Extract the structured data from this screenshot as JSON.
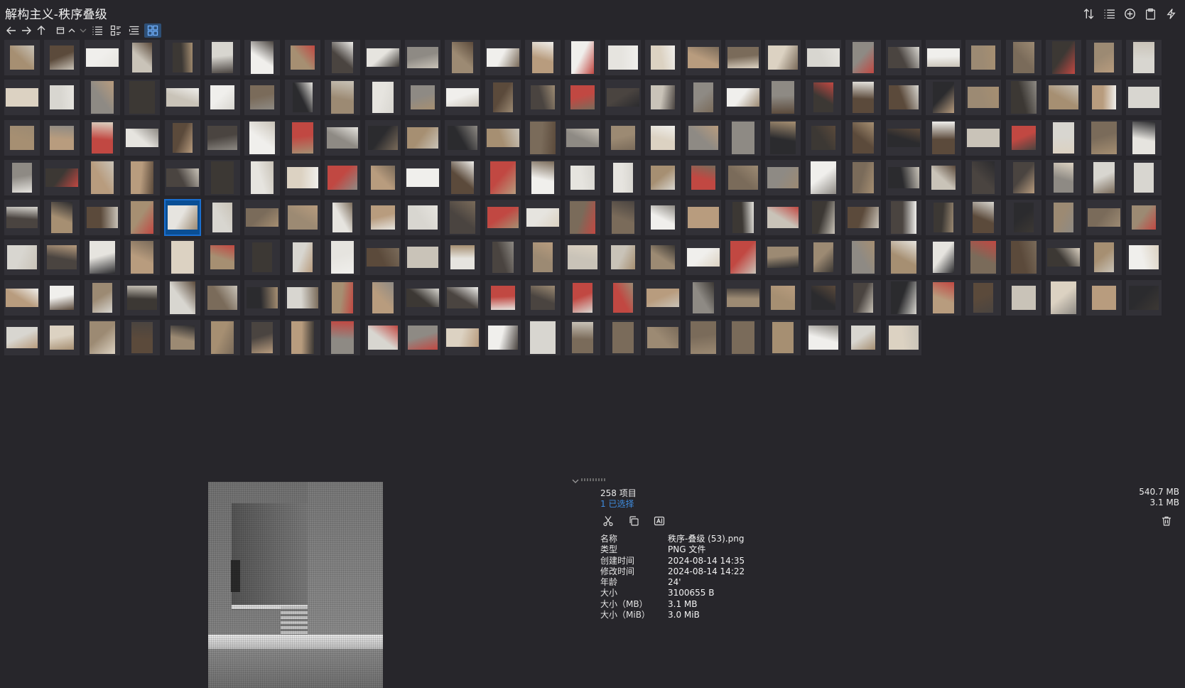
{
  "window": {
    "title": "解构主义-秩序叠级"
  },
  "nav": {
    "back_icon": "arrow-left-icon",
    "forward_icon": "arrow-right-icon",
    "up_icon": "arrow-up-icon",
    "active_view": "thumbnails"
  },
  "toolbar": {
    "icons": [
      "sort-icon",
      "details-list-icon",
      "add-circle-icon",
      "clipboard-icon",
      "lightning-icon"
    ]
  },
  "grid": {
    "columns": 29,
    "shown": 226,
    "selected_index": 120,
    "tones": [
      "#d8d6d0",
      "#c9c3b8",
      "#3c3834",
      "#b89c7e",
      "#e6e4df",
      "#8e8a84",
      "#f0efec",
      "#5b4a3b",
      "#a68f72",
      "#2b2b2e",
      "#c14842",
      "#7a6b5a",
      "#dcd2c2",
      "#9c8a73",
      "#4a4440"
    ]
  },
  "status": {
    "item_count": "258 项目",
    "selected_count": "1 已选择",
    "total_size": "540.7 MB",
    "selected_size": "3.1 MB"
  },
  "actions": {
    "cut_icon": "scissors-icon",
    "copy_icon": "copy-icon",
    "rename_icon": "rename-icon",
    "delete_icon": "trash-icon"
  },
  "properties": [
    {
      "label": "名称",
      "value": "秩序-叠级 (53).png"
    },
    {
      "label": "类型",
      "value": "PNG 文件"
    },
    {
      "label": "创建时间",
      "value": "2024-08-14  14:35"
    },
    {
      "label": "修改时间",
      "value": "2024-08-14  14:22"
    },
    {
      "label": "年龄",
      "value": "24'"
    },
    {
      "label": "大小",
      "value": "3100655 B"
    },
    {
      "label": "大小（MB）",
      "value": "3.1 MB"
    },
    {
      "label": "大小（MiB）",
      "value": "3.0 MiB"
    }
  ],
  "colors": {
    "background": "#27262b",
    "accent": "#3f8de0",
    "selection": "#0a4f95",
    "tile": "#323137"
  }
}
